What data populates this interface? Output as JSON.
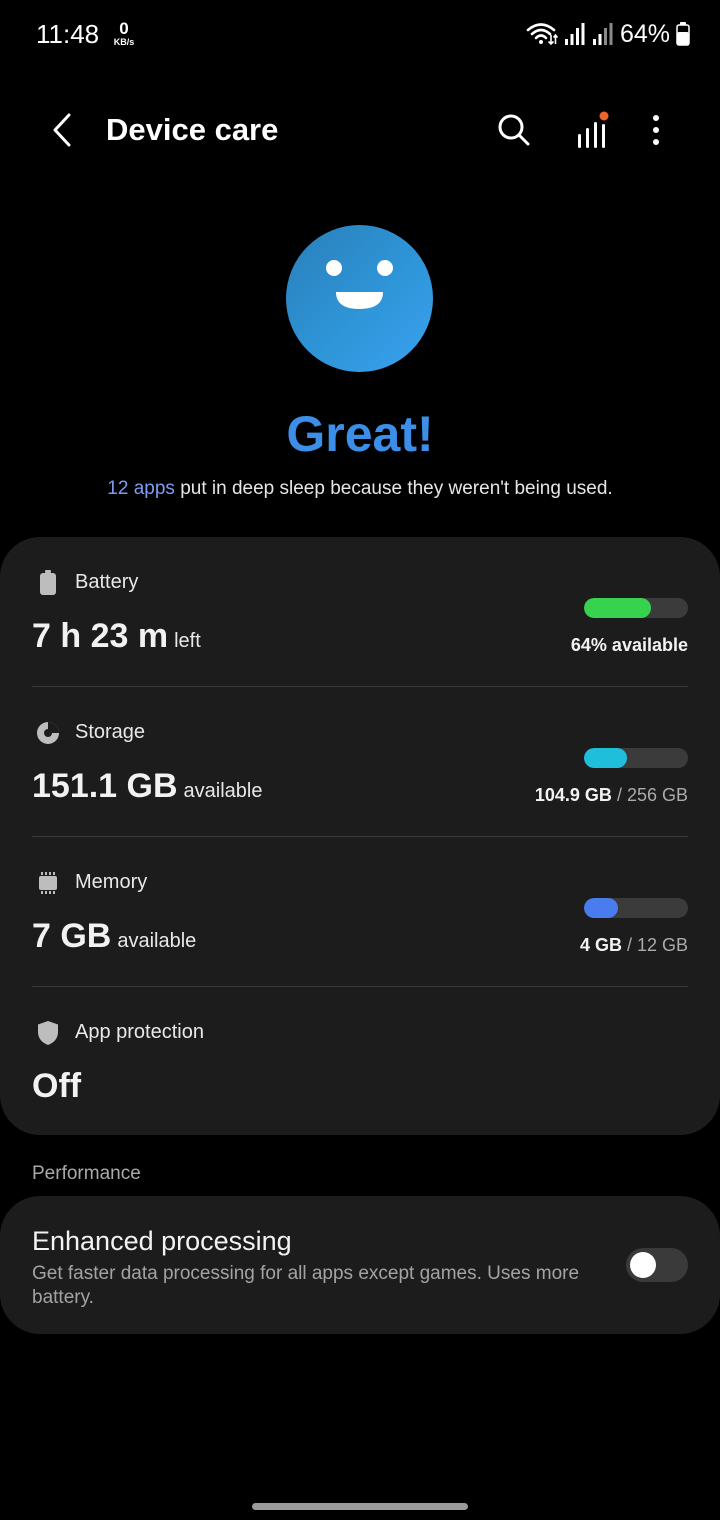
{
  "status_bar": {
    "time": "11:48",
    "net_speed_value": "0",
    "net_speed_unit": "KB/s",
    "battery_percent": "64%"
  },
  "header": {
    "title": "Device care",
    "icons": [
      "back-arrow-icon",
      "search-icon",
      "stats-icon",
      "more-options-icon"
    ]
  },
  "status": {
    "face_icon": "smiling-face-icon",
    "title": "Great!",
    "subtitle_link": "12 apps",
    "subtitle_rest": " put in deep sleep because they weren't being used."
  },
  "items": {
    "battery": {
      "label": "Battery",
      "value": "7 h 23 m",
      "suffix": "left",
      "detail": "64% available",
      "fraction": 0.64,
      "color": "#37d34f"
    },
    "storage": {
      "label": "Storage",
      "value": "151.1 GB",
      "suffix": "available",
      "used": "104.9 GB",
      "total": "/ 256 GB",
      "fraction": 0.41,
      "color": "#1fbfdc"
    },
    "memory": {
      "label": "Memory",
      "value": "7 GB",
      "suffix": "available",
      "used": "4 GB",
      "total": "/ 12 GB",
      "fraction": 0.33,
      "color": "#4a7cf0"
    },
    "app_protection": {
      "label": "App protection",
      "value": "Off"
    }
  },
  "performance": {
    "section_title": "Performance",
    "enhanced_title": "Enhanced processing",
    "enhanced_desc": "Get faster data processing for all apps except games. Uses more battery.",
    "enhanced_on": false
  }
}
